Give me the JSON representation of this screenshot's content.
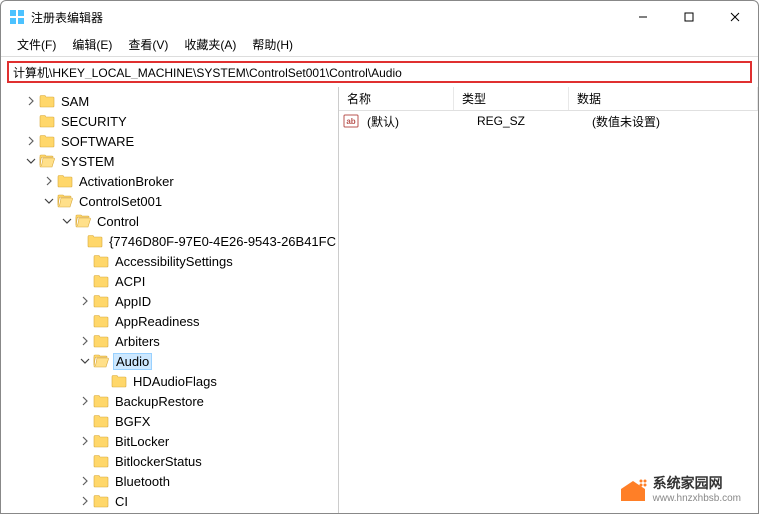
{
  "window": {
    "title": "注册表编辑器"
  },
  "menubar": {
    "file": "文件(F)",
    "edit": "编辑(E)",
    "view": "查看(V)",
    "favorites": "收藏夹(A)",
    "help": "帮助(H)"
  },
  "address": {
    "path": "计算机\\HKEY_LOCAL_MACHINE\\SYSTEM\\ControlSet001\\Control\\Audio"
  },
  "tree": [
    {
      "label": "SAM",
      "indent": 1,
      "expander": "right",
      "open": false
    },
    {
      "label": "SECURITY",
      "indent": 1,
      "expander": "none",
      "open": false
    },
    {
      "label": "SOFTWARE",
      "indent": 1,
      "expander": "right",
      "open": false
    },
    {
      "label": "SYSTEM",
      "indent": 1,
      "expander": "down",
      "open": true
    },
    {
      "label": "ActivationBroker",
      "indent": 2,
      "expander": "right",
      "open": false
    },
    {
      "label": "ControlSet001",
      "indent": 2,
      "expander": "down",
      "open": true
    },
    {
      "label": "Control",
      "indent": 3,
      "expander": "down",
      "open": true
    },
    {
      "label": "{7746D80F-97E0-4E26-9543-26B41FC",
      "indent": 4,
      "expander": "none",
      "open": false
    },
    {
      "label": "AccessibilitySettings",
      "indent": 4,
      "expander": "none",
      "open": false
    },
    {
      "label": "ACPI",
      "indent": 4,
      "expander": "none",
      "open": false
    },
    {
      "label": "AppID",
      "indent": 4,
      "expander": "right",
      "open": false
    },
    {
      "label": "AppReadiness",
      "indent": 4,
      "expander": "none",
      "open": false
    },
    {
      "label": "Arbiters",
      "indent": 4,
      "expander": "right",
      "open": false
    },
    {
      "label": "Audio",
      "indent": 4,
      "expander": "down",
      "open": true,
      "selected": true
    },
    {
      "label": "HDAudioFlags",
      "indent": 5,
      "expander": "none",
      "open": false
    },
    {
      "label": "BackupRestore",
      "indent": 4,
      "expander": "right",
      "open": false
    },
    {
      "label": "BGFX",
      "indent": 4,
      "expander": "none",
      "open": false
    },
    {
      "label": "BitLocker",
      "indent": 4,
      "expander": "right",
      "open": false
    },
    {
      "label": "BitlockerStatus",
      "indent": 4,
      "expander": "none",
      "open": false
    },
    {
      "label": "Bluetooth",
      "indent": 4,
      "expander": "right",
      "open": false
    },
    {
      "label": "CI",
      "indent": 4,
      "expander": "right",
      "open": false
    }
  ],
  "list": {
    "headers": {
      "name": "名称",
      "type": "类型",
      "data": "数据"
    },
    "rows": [
      {
        "name": "(默认)",
        "type": "REG_SZ",
        "data": "(数值未设置)"
      }
    ]
  },
  "watermark": {
    "line1": "系统家园网",
    "line2": "www.hnzxhbsb.com"
  }
}
